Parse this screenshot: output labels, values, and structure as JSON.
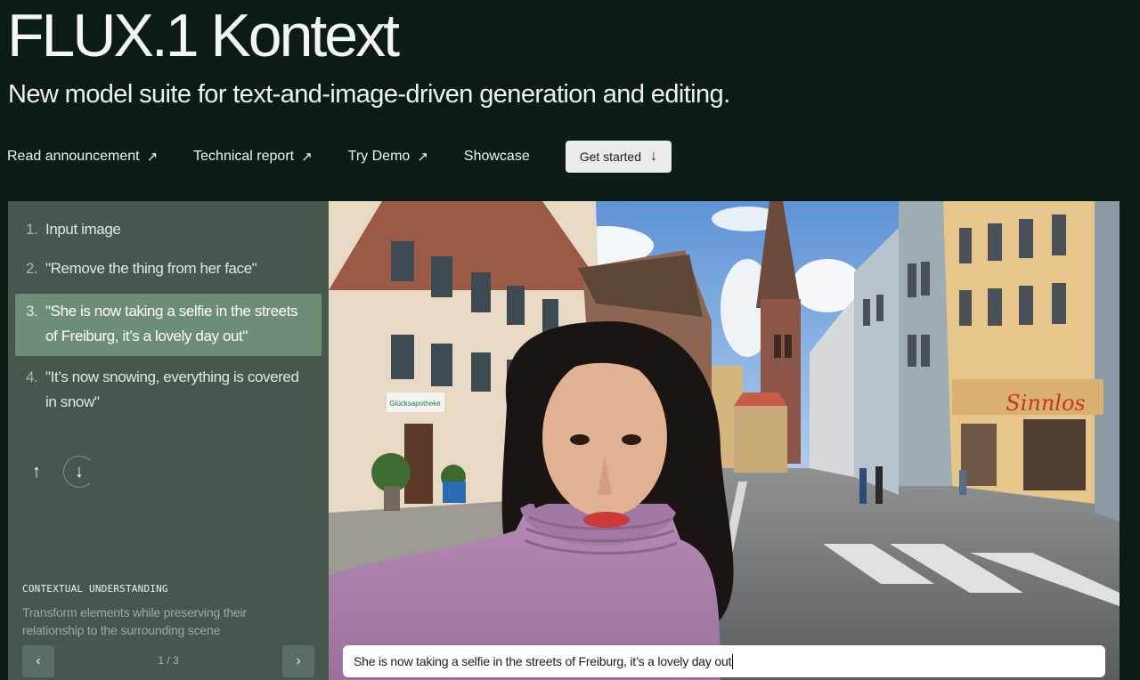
{
  "hero": {
    "title": "FLUX.1 Kontext",
    "subtitle": "New model suite for text-and-image-driven generation and editing."
  },
  "nav": {
    "links": [
      {
        "label": "Read announcement",
        "icon": "arrow-up-right-icon"
      },
      {
        "label": "Technical report",
        "icon": "arrow-up-right-icon"
      },
      {
        "label": "Try Demo",
        "icon": "arrow-up-right-icon"
      },
      {
        "label": "Showcase"
      }
    ],
    "cta": {
      "label": "Get started",
      "icon": "arrow-down-icon"
    }
  },
  "steps": [
    {
      "num": "1.",
      "text": "Input image",
      "active": false
    },
    {
      "num": "2.",
      "text": "\"Remove the thing from her face\"",
      "active": false
    },
    {
      "num": "3.",
      "text": "\"She is now taking a selfie in the streets of Freiburg, it’s a lovely day out\"",
      "active": true
    },
    {
      "num": "4.",
      "text": "\"It’s now snowing, everything is covered in snow\"",
      "active": false
    }
  ],
  "panel": {
    "caption_label": "CONTEXTUAL UNDERSTANDING",
    "caption_desc": "Transform elements while preserving their relationship to the surrounding scene",
    "pager": {
      "current": 1,
      "total": 3,
      "text": "1 / 3"
    }
  },
  "scene": {
    "prompt": "She is now taking a selfie in the streets of Freiburg, it’s a lovely day out",
    "shop_sign_text": "Sinnlos",
    "pharmacy_sign_text": "Glücksapotheke"
  },
  "colors": {
    "background": "#0b1c14",
    "panel": "#46584d",
    "active_step": "#6e8d79"
  }
}
